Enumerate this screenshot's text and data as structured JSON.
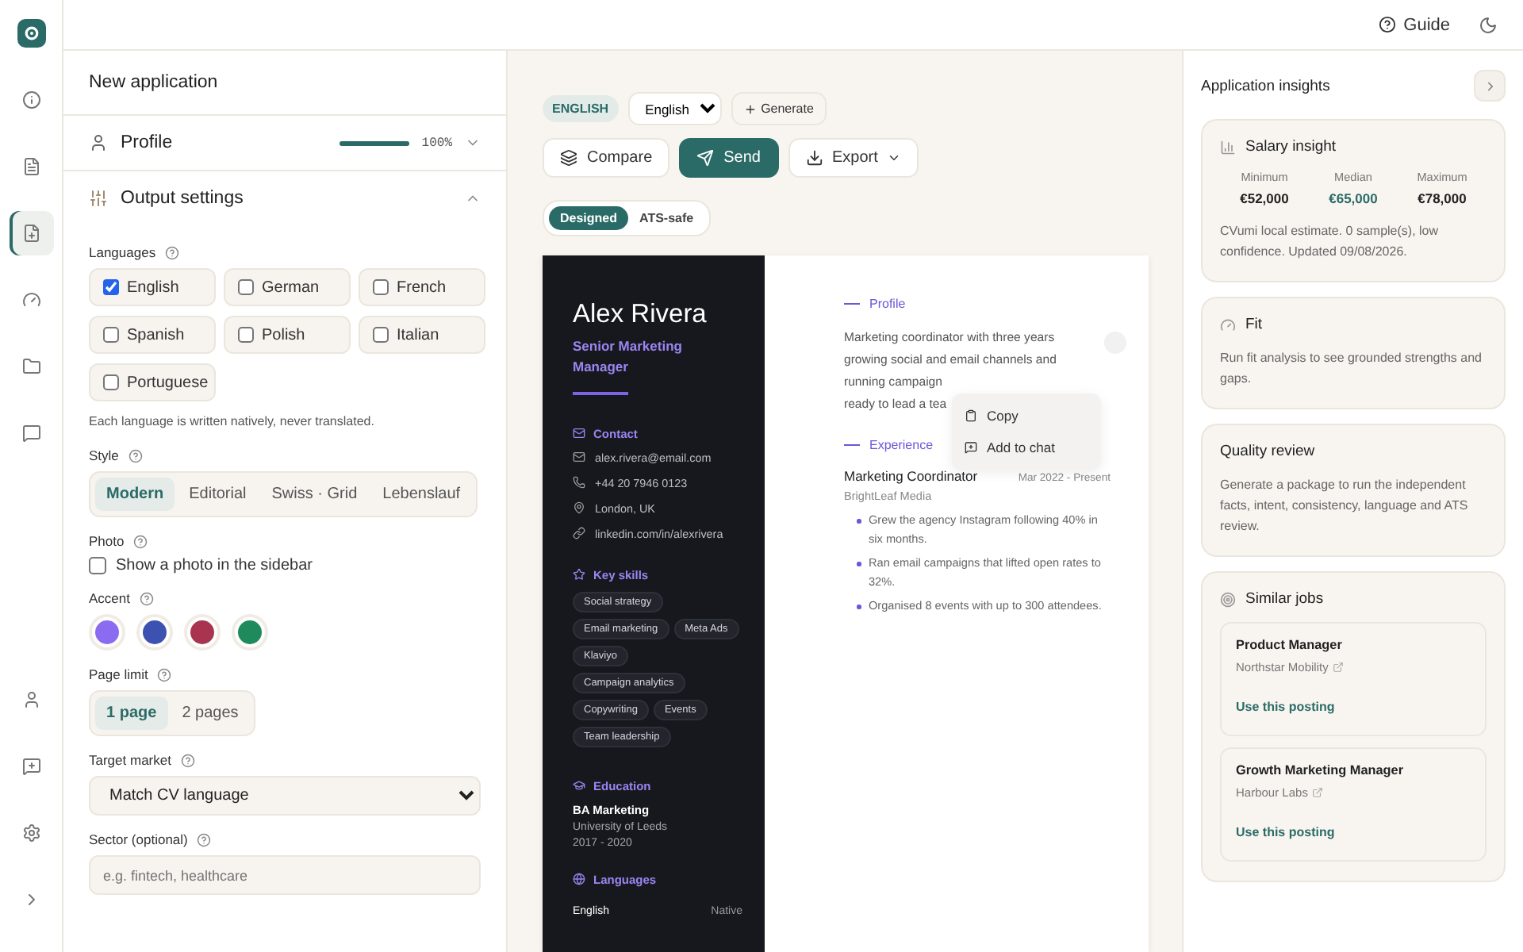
{
  "topbar": {
    "guide": "Guide"
  },
  "rail": {
    "top": [
      {
        "kind": "info",
        "selected": false
      },
      {
        "kind": "file",
        "selected": false
      },
      {
        "kind": "file-plus",
        "selected": true
      },
      {
        "kind": "gauge",
        "selected": false
      },
      {
        "kind": "folder",
        "selected": false
      },
      {
        "kind": "chat",
        "selected": false
      }
    ],
    "bottom": [
      {
        "kind": "user"
      },
      {
        "kind": "chat-plus"
      },
      {
        "kind": "settings"
      },
      {
        "kind": "expand"
      }
    ]
  },
  "left_panel": {
    "title": "New application",
    "profile": {
      "title": "Profile",
      "level": 1,
      "reading": "100%",
      "expanded": false
    },
    "output_settings": {
      "title": "Output settings",
      "expanded": true,
      "languages": {
        "label": "Languages",
        "options": [
          {
            "label": "English",
            "checked": true
          },
          {
            "label": "German",
            "checked": false
          },
          {
            "label": "French",
            "checked": false
          },
          {
            "label": "Spanish",
            "checked": false
          },
          {
            "label": "Polish",
            "checked": false
          },
          {
            "label": "Italian",
            "checked": false
          },
          {
            "label": "Portuguese",
            "checked": false
          }
        ],
        "note": "Each language is written natively, never translated."
      },
      "style": {
        "label": "Style",
        "options": [
          {
            "label": "Modern",
            "selected": true
          },
          {
            "label": "Editorial",
            "selected": false
          },
          {
            "label": "Swiss · Grid",
            "selected": false
          },
          {
            "label": "Lebenslauf",
            "selected": false
          }
        ]
      },
      "photo": {
        "label": "Photo",
        "option": "Show a photo in the sidebar",
        "checked": false
      },
      "accent": {
        "label": "Accent",
        "swatches": [
          {
            "color": "#8b6cf0"
          },
          {
            "color": "#3d52b0"
          },
          {
            "color": "#a8344f"
          },
          {
            "color": "#1f8a5c"
          }
        ]
      },
      "page_limit": {
        "label": "Page limit",
        "options": [
          {
            "label": "1 page",
            "selected": true
          },
          {
            "label": "2 pages",
            "selected": false
          }
        ]
      },
      "target_market": {
        "label": "Target market",
        "value": "Match CV language"
      },
      "sector": {
        "label": "Sector (optional)",
        "placeholder": "e.g. fintech, healthcare"
      }
    }
  },
  "center": {
    "language_badge": "ENGLISH",
    "language_select": "English",
    "generate": "Generate",
    "actions": [
      {
        "label": "Compare",
        "kind": "compare"
      },
      {
        "label": "Send",
        "kind": "primary"
      },
      {
        "label": "Export",
        "kind": "menu"
      }
    ],
    "view_toggle": [
      {
        "label": "Designed",
        "selected": true
      },
      {
        "label": "ATS-safe",
        "selected": false
      }
    ],
    "resume": {
      "name": "Alex Rivera",
      "title": "Senior Marketing Manager",
      "contact": {
        "heading": "Contact",
        "items": [
          {
            "kind": "email",
            "text": "alex.rivera@email.com"
          },
          {
            "kind": "phone",
            "text": "+44 20 7946 0123"
          },
          {
            "kind": "location",
            "text": "London, UK"
          },
          {
            "kind": "link",
            "text": "linkedin.com/in/alexrivera"
          }
        ]
      },
      "skills": {
        "heading": "Key skills",
        "items": [
          "Social strategy",
          "Email marketing",
          "Meta Ads",
          "Klaviyo",
          "Campaign analytics",
          "Copywriting",
          "Events",
          "Team leadership"
        ]
      },
      "education": {
        "heading": "Education",
        "degree": "BA Marketing",
        "school": "University of Leeds",
        "years": "2017 - 2020"
      },
      "languages": {
        "heading": "Languages",
        "items": [
          {
            "name": "English",
            "level": "Native"
          }
        ]
      },
      "profile": {
        "heading": "Profile",
        "lines": [
          "Marketing coordinator with three years",
          "growing social and email channels and",
          "running campaign",
          "ready to lead a tea"
        ]
      },
      "experience": {
        "heading": "Experience",
        "job": {
          "title": "Marketing Coordinator",
          "dates": "Mar 2022 - Present",
          "company": "BrightLeaf Media",
          "bullets": [
            "Grew the agency Instagram following 40% in six months.",
            "Ran email campaigns that lifted open rates to 32%.",
            "Organised 8 events with up to 300 attendees."
          ]
        }
      }
    },
    "context_menu": [
      {
        "kind": "copy",
        "label": "Copy"
      },
      {
        "kind": "chat",
        "label": "Add to chat"
      }
    ]
  },
  "right_panel": {
    "title": "Application insights",
    "cards": [
      {
        "kind": "salary",
        "title": "Salary insight",
        "stats": [
          {
            "label": "Minimum",
            "value": "€52,000",
            "highlight": false
          },
          {
            "label": "Median",
            "value": "€65,000",
            "highlight": true
          },
          {
            "label": "Maximum",
            "value": "€78,000",
            "highlight": false
          }
        ],
        "text": "CVumi local estimate. 0 sample(s), low confidence. Updated 09/08/2026."
      },
      {
        "kind": "fit",
        "title": "Fit",
        "text": "Run fit analysis to see grounded strengths and gaps."
      },
      {
        "kind": "plain",
        "title": "Quality review",
        "text": "Generate a package to run the independent facts, intent, consistency, language and ATS review."
      },
      {
        "kind": "jobs",
        "title": "Similar jobs",
        "jobs": [
          {
            "title": "Product Manager",
            "company": "Northstar Mobility",
            "action": "Use this posting"
          },
          {
            "title": "Growth Marketing Manager",
            "company": "Harbour Labs",
            "action": "Use this posting"
          }
        ]
      }
    ]
  }
}
